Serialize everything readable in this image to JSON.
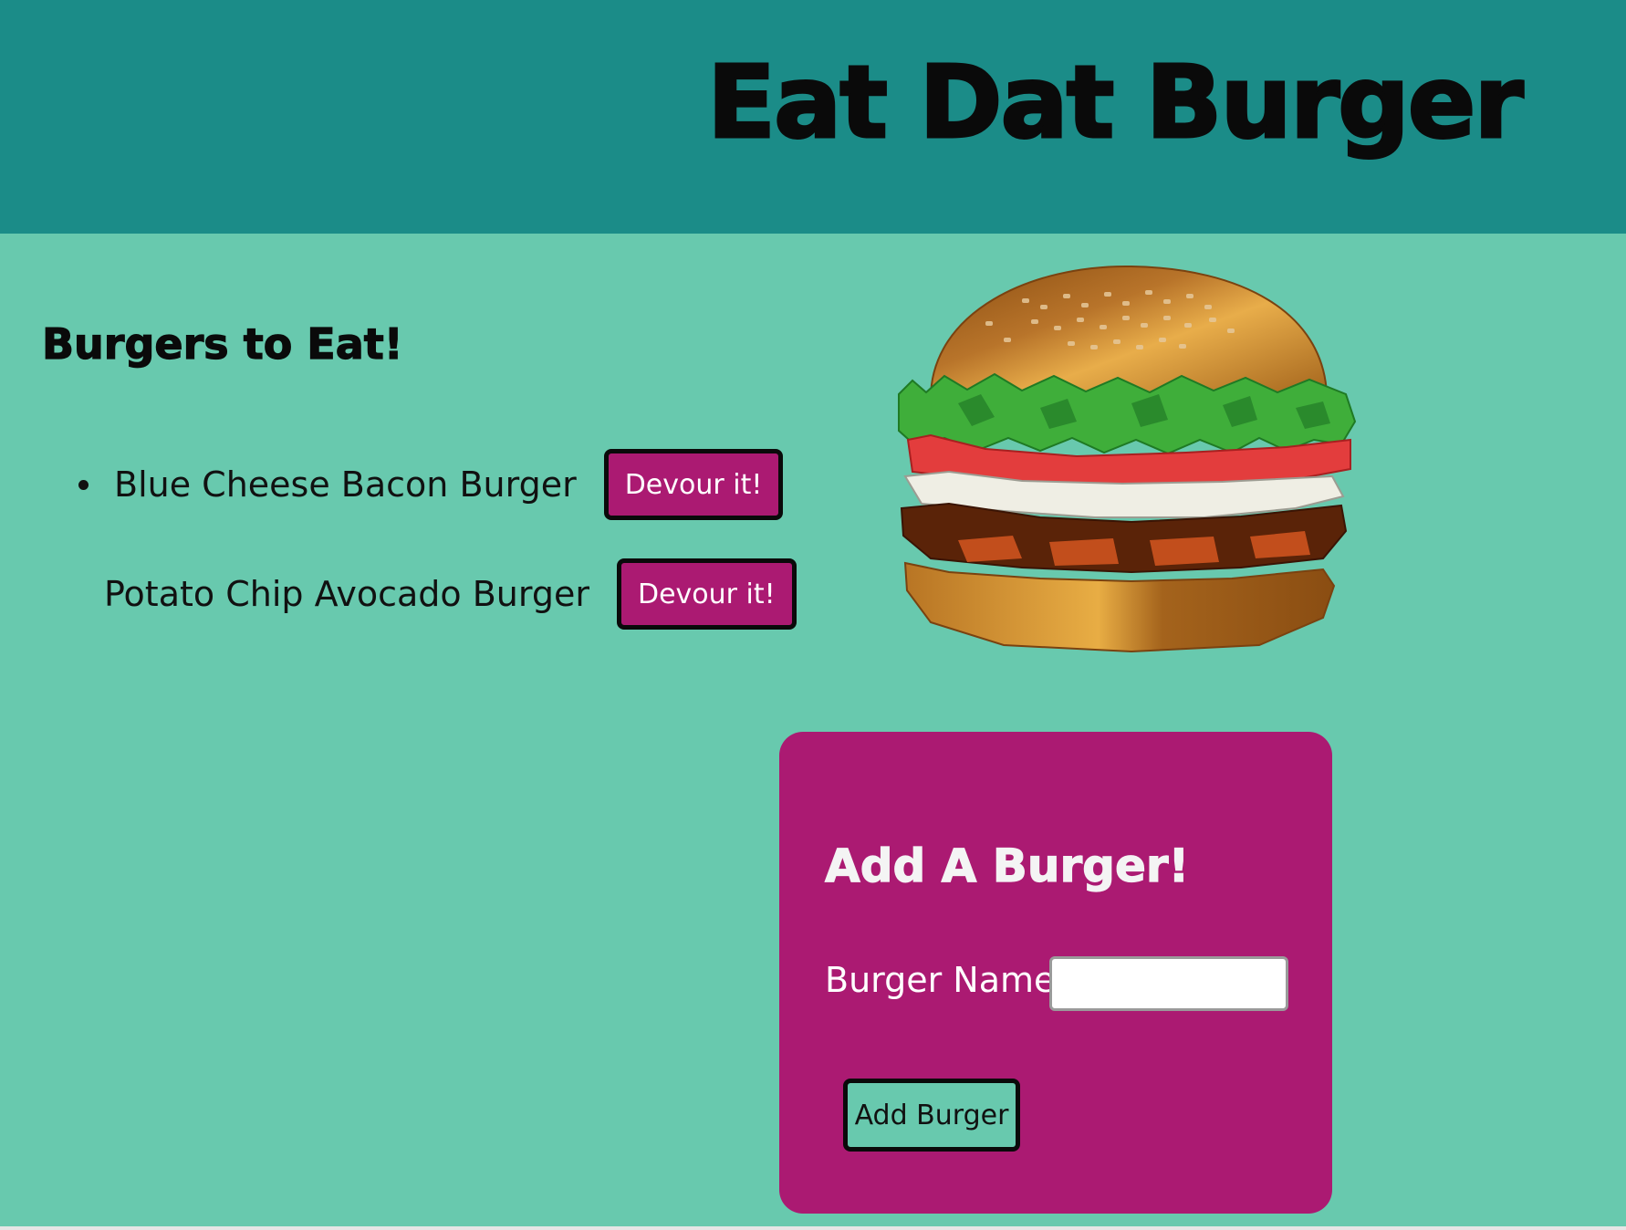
{
  "header": {
    "title": "Eat Dat Burger"
  },
  "list_section": {
    "title": "Burgers to Eat!",
    "items": [
      {
        "name": "Blue Cheese Bacon Burger",
        "button_label": "Devour it!"
      },
      {
        "name": "Potato Chip Avocado Burger",
        "button_label": "Devour it!"
      }
    ]
  },
  "add_form": {
    "title": "Add A Burger!",
    "name_label": "Burger Name:",
    "name_value": "",
    "submit_label": "Add Burger"
  },
  "colors": {
    "header_bg": "#1b8c88",
    "page_bg": "#68c9ae",
    "accent": "#ab1a72"
  },
  "icons": {
    "burger_image": "hamburger-illustration"
  }
}
